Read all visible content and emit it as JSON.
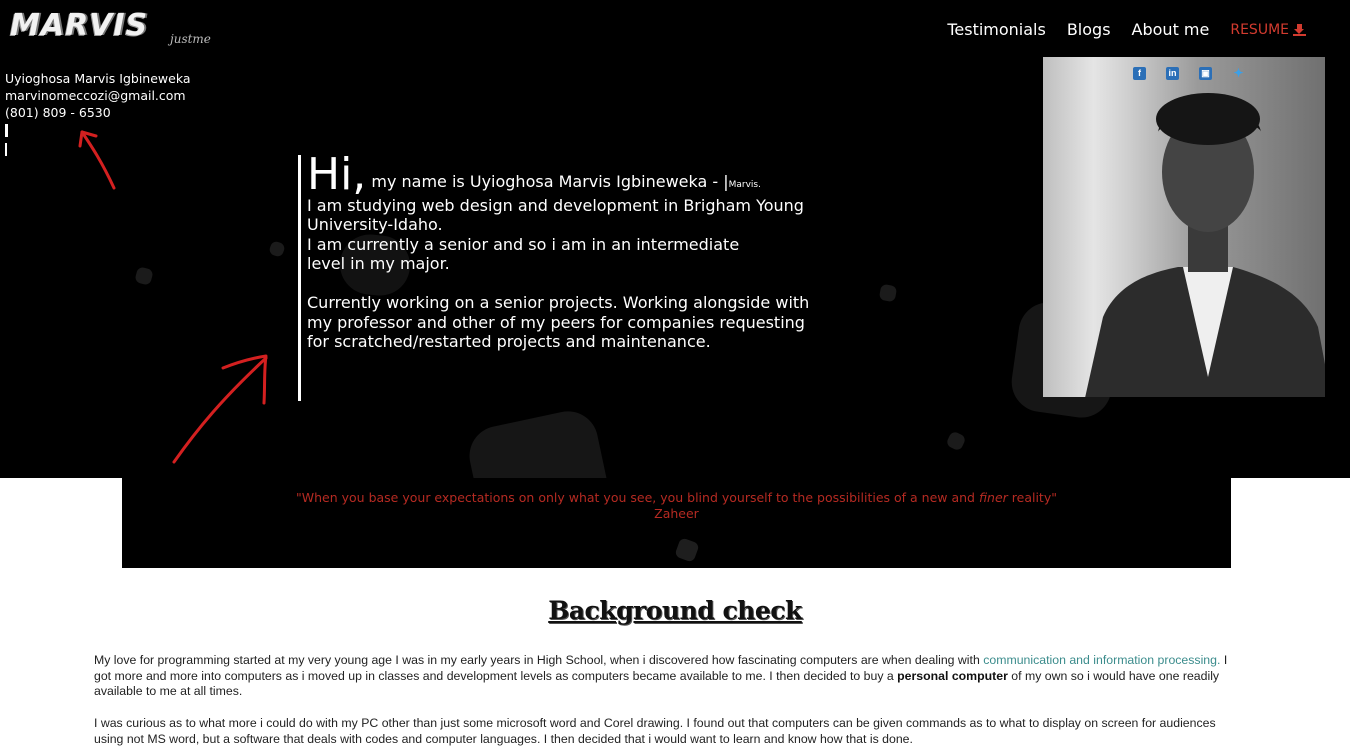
{
  "logo": {
    "main": "MARVIS",
    "sub": "justme"
  },
  "nav": {
    "items": [
      "Testimonials",
      "Blogs",
      "About me"
    ],
    "resume_label": "RESUME",
    "resume_icon": "download-icon",
    "accent": "#d23b2f"
  },
  "contact": {
    "name": "Uyioghosa Marvis Igbineweka",
    "email": "marvinomeccozi@gmail.com",
    "phone": "(801) 809 - 6530"
  },
  "intro": {
    "hi": "Hi,",
    "line1": " my name is Uyioghosa Marvis Igbineweka - |",
    "nick": "Marvis.",
    "p1": "I am studying web design and development in Brigham Young University-Idaho.",
    "p2a": "I am currently a senior and so i am in an intermediate",
    "p2b": "level in my major.",
    "p3": "Currently working on a senior projects. Working alongside with my professor and other of my peers for companies requesting for scratched/restarted projects and maintenance."
  },
  "social": [
    "facebook-icon",
    "linkedin-icon",
    "instagram-icon",
    "twitter-icon"
  ],
  "quote": {
    "text_a": "\"When you base your expectations on only what you see, you blind yourself to the possibilities of a new and ",
    "text_em": "finer",
    "text_b": " reality\"",
    "author": "Zaheer",
    "color": "#b52a22"
  },
  "background": {
    "title": "Background check",
    "p1_a": "My love for programming started at my very young age I was in my early years in High School, when i discovered how fascinating computers are when dealing with ",
    "p1_link": "communication and information processing.",
    "p1_b": " I got more and more into computers as i moved up in classes and development levels as computers became available to me. I then decided to buy a ",
    "p1_bold": "personal computer",
    "p1_c": " of my own so i would have one readily available to me at all times.",
    "p2": "I was curious as to what more i could do with my PC other than just some microsoft word and Corel drawing. I found out that computers can be given commands as to what to display on screen for audiences using not MS word, but a software that deals with codes and computer languages. I then decided that i would want to learn and know how that is done."
  }
}
